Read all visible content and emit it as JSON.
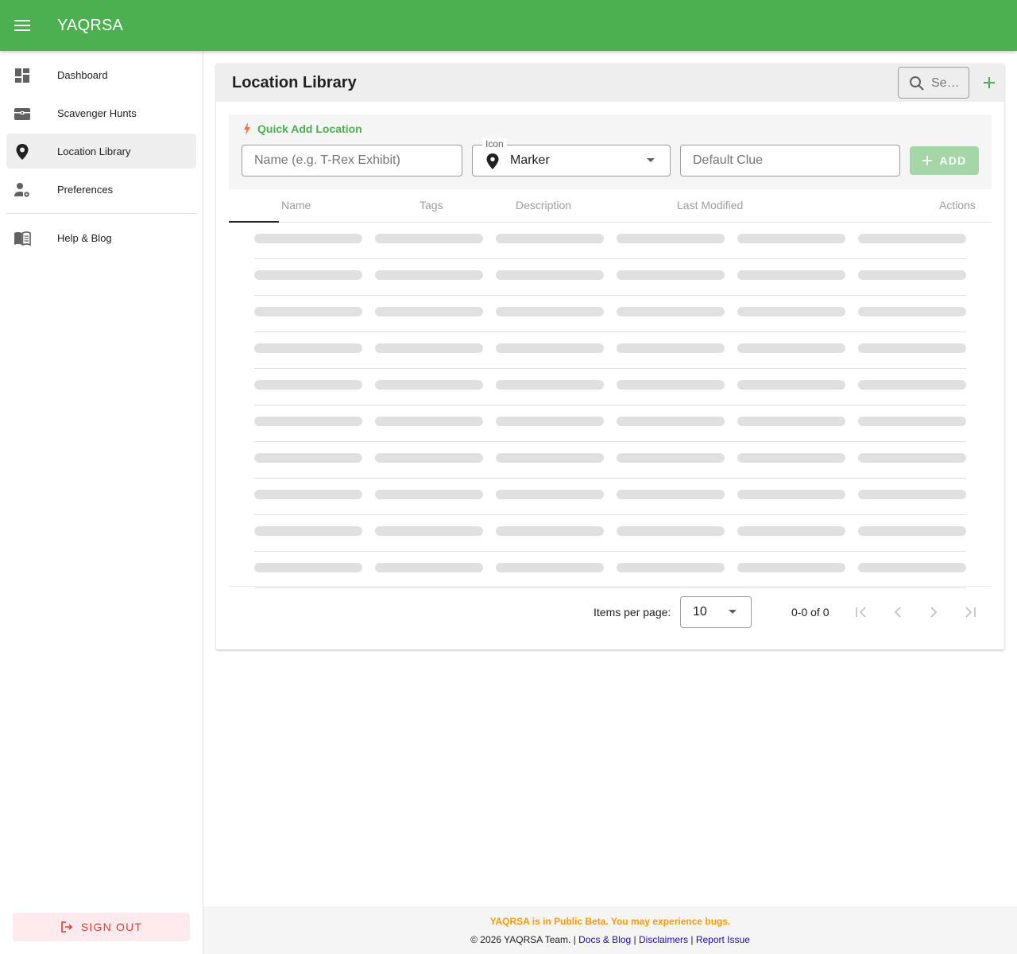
{
  "app": {
    "title": "YAQRSA"
  },
  "icons": {
    "menu": "menu-icon",
    "search": "search-icon",
    "add": "plus-icon",
    "quick": "bolt-icon",
    "marker": "map-marker-icon"
  },
  "colors": {
    "primary": "#4caf50",
    "accent_warning": "#ff9800",
    "danger": "#e53935",
    "link": "#1a0dab"
  },
  "sidebar": {
    "items": [
      {
        "label": "Dashboard",
        "icon": "dashboard-icon",
        "active": false
      },
      {
        "label": "Scavenger Hunts",
        "icon": "treasure-chest-icon",
        "active": false
      },
      {
        "label": "Location Library",
        "icon": "location-pin-icon",
        "active": true
      },
      {
        "label": "Preferences",
        "icon": "user-gear-icon",
        "active": false
      },
      {
        "label": "Help & Blog",
        "icon": "book-icon",
        "active": false
      }
    ],
    "sign_out": "SIGN OUT"
  },
  "card": {
    "title": "Location Library",
    "search_placeholder": "Se…"
  },
  "quick_add": {
    "title": "Quick Add Location",
    "name_placeholder": "Name (e.g. T-Rex Exhibit)",
    "icon_label": "Icon",
    "icon_value": "Marker",
    "clue_placeholder": "Default Clue",
    "add_label": "ADD"
  },
  "table": {
    "columns": [
      "Name",
      "Tags",
      "Description",
      "Last Modified",
      "Actions"
    ],
    "loading_rows": 10
  },
  "paginator": {
    "items_per_page_label": "Items per page:",
    "items_per_page": "10",
    "range": "0-0 of 0"
  },
  "footer": {
    "beta_notice": "YAQRSA is in Public Beta. You may experience bugs.",
    "copyright": "© 2026 YAQRSA Team. |",
    "links": [
      "Docs & Blog",
      "Disclaimers",
      "Report Issue"
    ]
  }
}
